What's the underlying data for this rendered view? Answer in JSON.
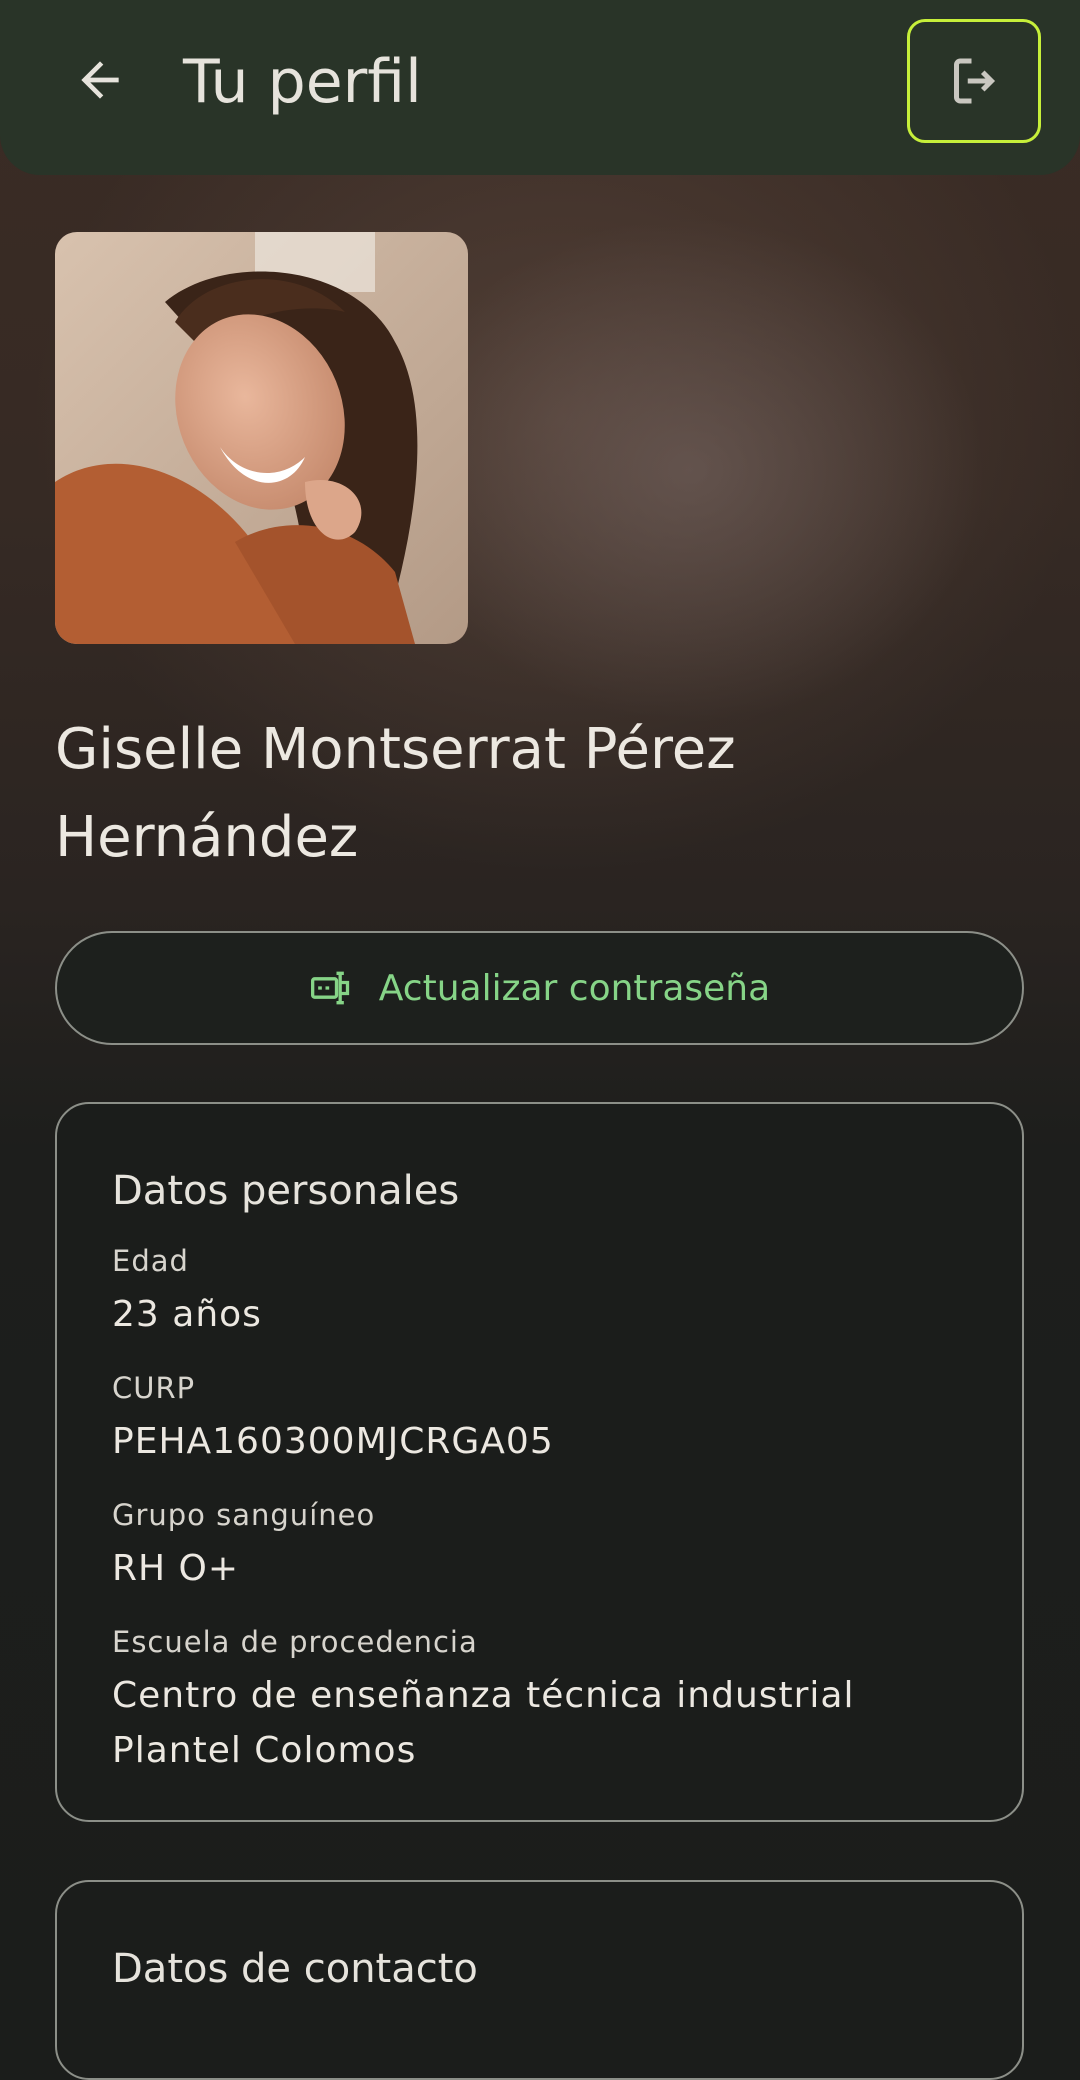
{
  "header": {
    "title": "Tu perfil",
    "back_icon": "arrow-left-icon",
    "logout_icon": "logout-icon"
  },
  "profile": {
    "name": "Giselle Montserrat Pérez Hernández"
  },
  "actions": {
    "update_password_label": "Actualizar contraseña",
    "update_password_icon": "password-icon"
  },
  "personal": {
    "title": "Datos personales",
    "fields": [
      {
        "label": "Edad",
        "value": "23 años"
      },
      {
        "label": "CURP",
        "value": "PEHA160300MJCRGA05"
      },
      {
        "label": "Grupo sanguíneo",
        "value": "RH O+"
      },
      {
        "label": "Escuela de procedencia",
        "value": "Centro de enseñanza técnica industrial Plantel Colomos"
      }
    ]
  },
  "contact": {
    "title": "Datos de contacto"
  },
  "colors": {
    "header_bg": "#293428",
    "accent_green": "#86d487",
    "focus_ring": "#c6ef3a",
    "card_bg": "#1b1d1b"
  }
}
